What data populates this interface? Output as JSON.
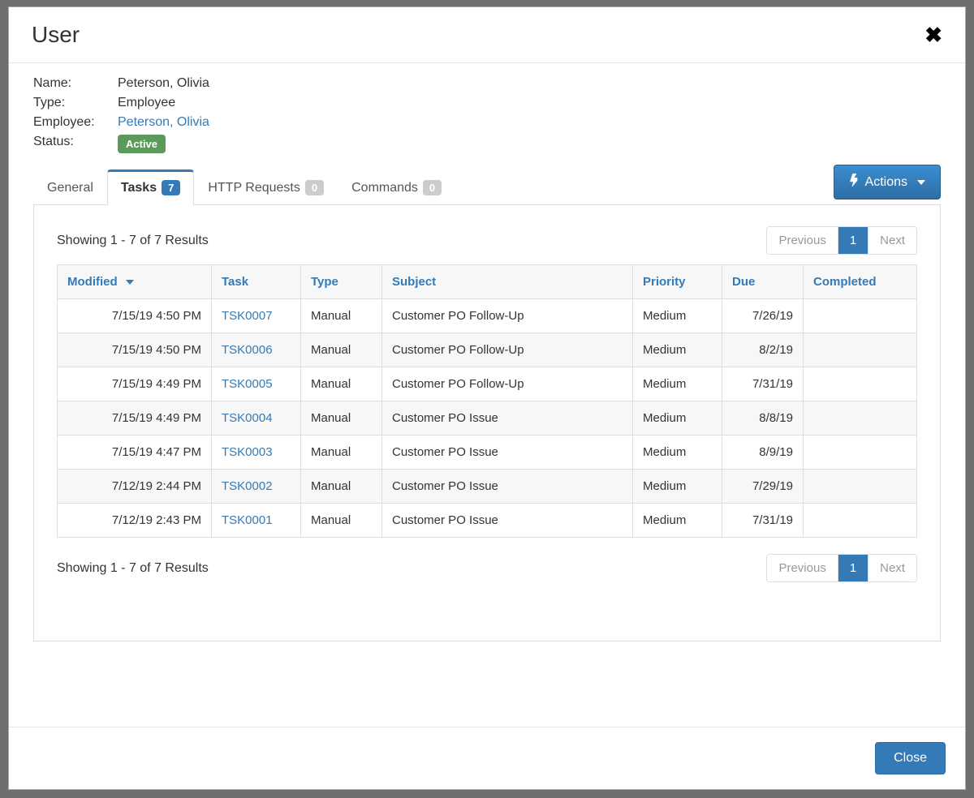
{
  "modal": {
    "title": "User",
    "close_label": "Close"
  },
  "info": {
    "name_label": "Name:",
    "name_value": "Peterson, Olivia",
    "type_label": "Type:",
    "type_value": "Employee",
    "employee_label": "Employee:",
    "employee_link": "Peterson, Olivia",
    "status_label": "Status:",
    "status_badge": "Active"
  },
  "tabs": {
    "general": "General",
    "tasks": "Tasks",
    "tasks_count": "7",
    "http": "HTTP Requests",
    "http_count": "0",
    "commands": "Commands",
    "commands_count": "0"
  },
  "actions_label": "Actions",
  "results": {
    "summary": "Showing 1 - 7 of 7 Results",
    "prev": "Previous",
    "page": "1",
    "next": "Next"
  },
  "columns": {
    "modified": "Modified",
    "task": "Task",
    "type": "Type",
    "subject": "Subject",
    "priority": "Priority",
    "due": "Due",
    "completed": "Completed"
  },
  "rows": [
    {
      "modified": "7/15/19 4:50 PM",
      "task": "TSK0007",
      "type": "Manual",
      "subject": "Customer PO Follow-Up",
      "priority": "Medium",
      "due": "7/26/19",
      "completed": ""
    },
    {
      "modified": "7/15/19 4:50 PM",
      "task": "TSK0006",
      "type": "Manual",
      "subject": "Customer PO Follow-Up",
      "priority": "Medium",
      "due": "8/2/19",
      "completed": ""
    },
    {
      "modified": "7/15/19 4:49 PM",
      "task": "TSK0005",
      "type": "Manual",
      "subject": "Customer PO Follow-Up",
      "priority": "Medium",
      "due": "7/31/19",
      "completed": ""
    },
    {
      "modified": "7/15/19 4:49 PM",
      "task": "TSK0004",
      "type": "Manual",
      "subject": "Customer PO Issue",
      "priority": "Medium",
      "due": "8/8/19",
      "completed": ""
    },
    {
      "modified": "7/15/19 4:47 PM",
      "task": "TSK0003",
      "type": "Manual",
      "subject": "Customer PO Issue",
      "priority": "Medium",
      "due": "8/9/19",
      "completed": ""
    },
    {
      "modified": "7/12/19 2:44 PM",
      "task": "TSK0002",
      "type": "Manual",
      "subject": "Customer PO Issue",
      "priority": "Medium",
      "due": "7/29/19",
      "completed": ""
    },
    {
      "modified": "7/12/19 2:43 PM",
      "task": "TSK0001",
      "type": "Manual",
      "subject": "Customer PO Issue",
      "priority": "Medium",
      "due": "7/31/19",
      "completed": ""
    }
  ]
}
